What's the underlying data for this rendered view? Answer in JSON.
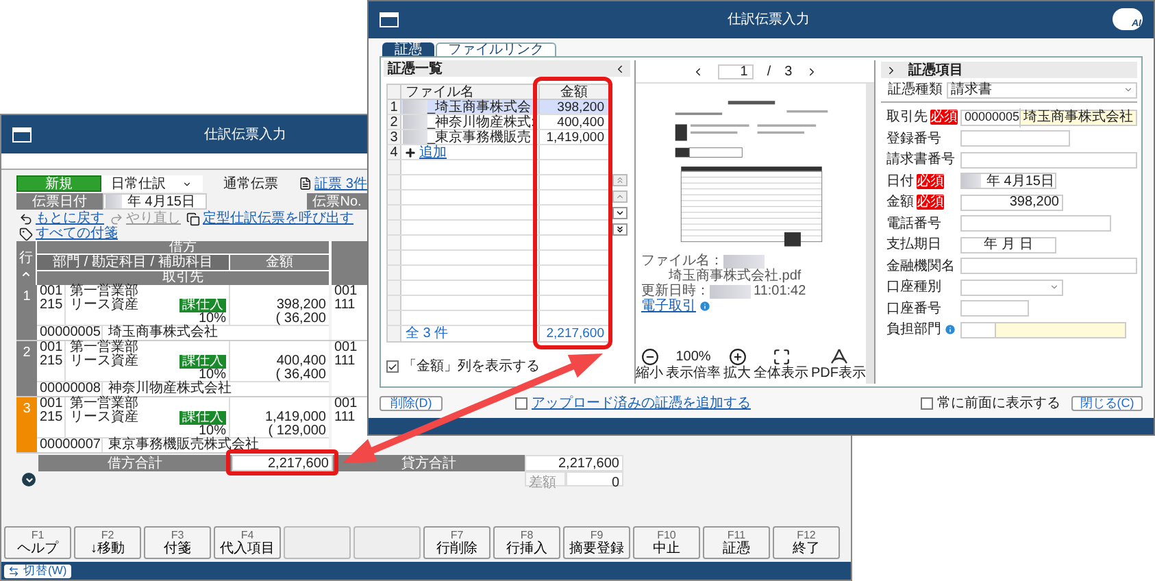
{
  "back_window": {
    "title": "仕訳伝票入力",
    "header": {
      "mode_label": "新規",
      "journal_type": "日常仕訳",
      "slip_type": "通常伝票",
      "voucher_link": "証票 3件",
      "date_label": "伝票日付",
      "date_value": "年 4月15日",
      "number_label": "伝票No."
    },
    "toolbar": [
      {
        "kind": "undo",
        "label": "もとに戻す"
      },
      {
        "kind": "redo",
        "label": "やり直し"
      },
      {
        "kind": "template",
        "label": "定型仕訳伝票を呼び出す"
      },
      {
        "kind": "notes",
        "label": "すべての付箋"
      }
    ],
    "table": {
      "row_header": "行",
      "debit_header": "借方",
      "columns": [
        "部門 / 勘定科目 / 補助科目",
        "金額"
      ],
      "partner_header": "取引先",
      "rows": [
        {
          "number": "1",
          "selected": false,
          "dept_code": "001",
          "dept": "第一営業部",
          "account_code": "215",
          "account": "リース資産",
          "tax_badge": "課仕入",
          "tax_rate": "10%",
          "amount": "398,200",
          "tax_amount": "( 36,200",
          "partner_code": "00000005",
          "partner": "埼玉商事株式会社",
          "credit_dept_code": "001",
          "credit_account_code": "111"
        },
        {
          "number": "2",
          "selected": false,
          "dept_code": "001",
          "dept": "第一営業部",
          "account_code": "215",
          "account": "リース資産",
          "tax_badge": "課仕入",
          "tax_rate": "10%",
          "amount": "400,400",
          "tax_amount": "( 36,400",
          "partner_code": "00000008",
          "partner": "神奈川物産株式会社",
          "credit_dept_code": "001",
          "credit_account_code": "111"
        },
        {
          "number": "3",
          "selected": true,
          "dept_code": "001",
          "dept": "第一営業部",
          "account_code": "215",
          "account": "リース資産",
          "tax_badge": "課仕入",
          "tax_rate": "10%",
          "amount": "1,419,000",
          "tax_amount": "( 129,000",
          "partner_code": "00000007",
          "partner": "東京事務機販売株式会社",
          "credit_dept_code": "001",
          "credit_account_code": "111"
        }
      ]
    },
    "totals": {
      "debit_label": "借方合計",
      "debit_value": "2,217,600",
      "credit_label": "貸方合計",
      "credit_value": "2,217,600",
      "diff_label": "差額",
      "diff_value": "0"
    },
    "function_keys": [
      {
        "kind": "key",
        "key": "F1",
        "label": "ヘルプ"
      },
      {
        "kind": "key",
        "key": "F2",
        "label": "↓移動"
      },
      {
        "kind": "key",
        "key": "F3",
        "label": "付箋"
      },
      {
        "kind": "key",
        "key": "F4",
        "label": "代入項目"
      },
      {
        "kind": "blank"
      },
      {
        "kind": "blank"
      },
      {
        "kind": "key",
        "key": "F7",
        "label": "行削除"
      },
      {
        "kind": "key",
        "key": "F8",
        "label": "行挿入"
      },
      {
        "kind": "key",
        "key": "F9",
        "label": "摘要登録"
      },
      {
        "kind": "key",
        "key": "F10",
        "label": "中止"
      },
      {
        "kind": "key",
        "key": "F11",
        "label": "証憑"
      },
      {
        "kind": "key",
        "key": "F12",
        "label": "終了"
      }
    ],
    "switch_button": "切替(W)"
  },
  "front_window": {
    "title": "仕訳伝票入力",
    "logo_text": "AI",
    "tabs": [
      {
        "label": "証憑",
        "selected": true
      },
      {
        "label": "ファイルリンク",
        "selected": false
      }
    ],
    "voucher_list": {
      "title": "証憑一覧",
      "columns": [
        "ファイル名",
        "金額"
      ],
      "rows": [
        {
          "number": "1",
          "file": "_埼玉商事株式会",
          "amount": "398,200",
          "selected": true
        },
        {
          "number": "2",
          "file": "_神奈川物産株式:",
          "amount": "400,400",
          "selected": false
        },
        {
          "number": "3",
          "file": "_東京事務機販売",
          "amount": "1,419,000",
          "selected": false
        }
      ],
      "add_row": {
        "number": "4",
        "label": "追加"
      },
      "footer_count": "全 3 件",
      "footer_total": "2,217,600",
      "show_amount": {
        "label": "「金額」列を表示する",
        "checked": true
      }
    },
    "preview": {
      "page": "1",
      "page_separator": "/",
      "page_total": "3",
      "file_label": "ファイル名：",
      "file_name": "埼玉商事株式会社.pdf",
      "updated_label": "更新日時：",
      "updated_time": "11:01:42",
      "e_transaction": "電子取引",
      "tools": [
        {
          "kind": "zoom_out",
          "label": "縮小"
        },
        {
          "kind": "zoom_level",
          "value": "100%",
          "label": "表示倍率"
        },
        {
          "kind": "zoom_in",
          "label": "拡大"
        },
        {
          "kind": "fit",
          "label": "全体表示"
        },
        {
          "kind": "pdf",
          "label": "PDF表示"
        }
      ]
    },
    "details": {
      "title": "証憑項目",
      "type_label": "証憑種類",
      "type_value": "請求書",
      "fields": [
        {
          "kind": "partner",
          "label": "取引先",
          "badge": "必須",
          "code": "00000005",
          "value": "埼玉商事株式会社"
        },
        {
          "kind": "text",
          "label": "登録番号"
        },
        {
          "kind": "text",
          "label": "請求書番号"
        },
        {
          "kind": "date",
          "label": "日付",
          "badge": "必須",
          "value": "年 4月15日"
        },
        {
          "kind": "amount",
          "label": "金額",
          "badge": "必須",
          "value": "398,200"
        },
        {
          "kind": "text",
          "label": "電話番号"
        },
        {
          "kind": "ymd",
          "label": "支払期日",
          "parts": [
            "年",
            "月",
            "日"
          ]
        },
        {
          "kind": "text",
          "label": "金融機関名"
        },
        {
          "kind": "select",
          "label": "口座種別"
        },
        {
          "kind": "text",
          "label": "口座番号"
        },
        {
          "kind": "department",
          "label": "負担部門"
        }
      ]
    },
    "footer": {
      "delete_button": "削除(D)",
      "upload": {
        "label": "アップロード済みの証憑を追加する",
        "checked": false
      },
      "always_on_top": {
        "label": "常に前面に表示する",
        "checked": false
      },
      "close_button": "閉じる(C)"
    }
  }
}
